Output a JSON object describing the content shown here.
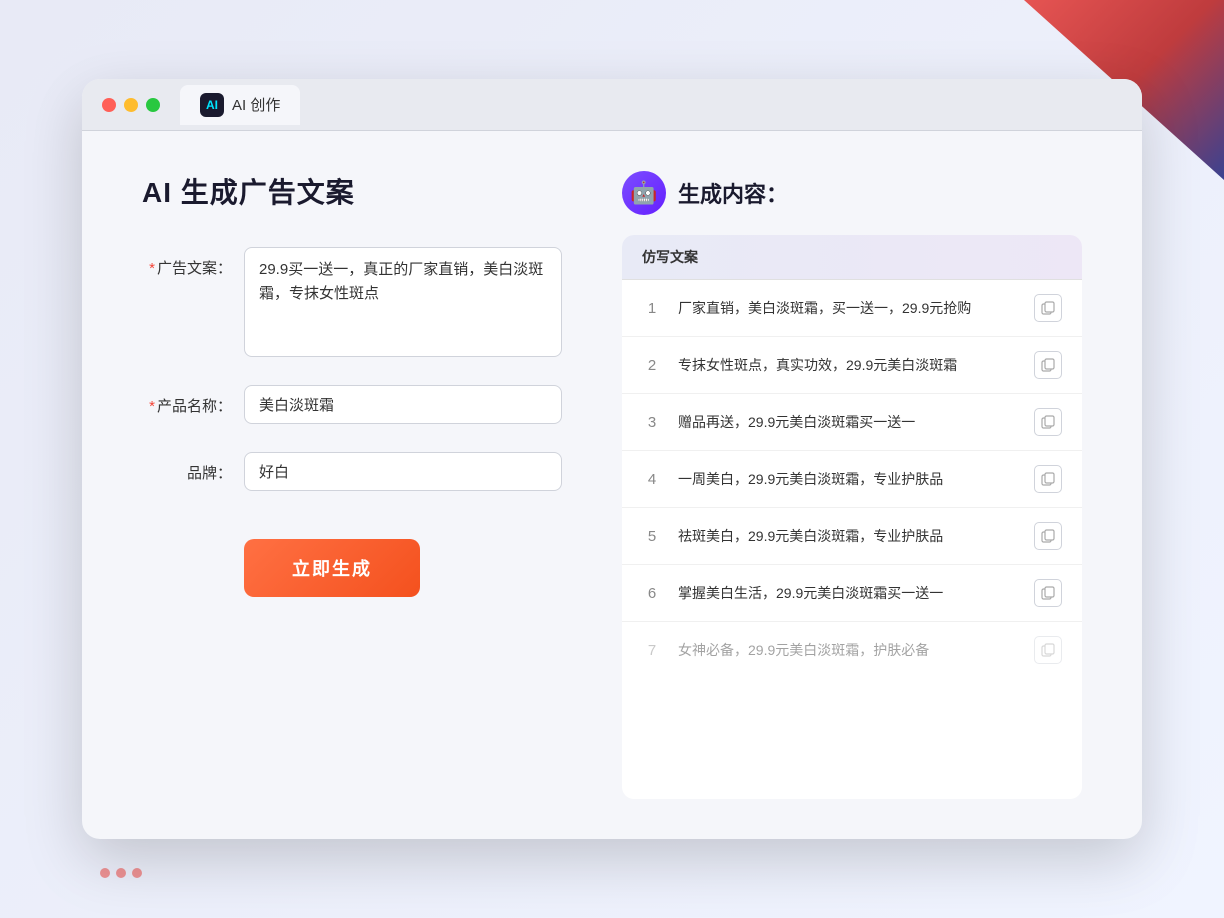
{
  "window": {
    "tab_label": "AI 创作",
    "tab_icon": "AI"
  },
  "left": {
    "page_title": "AI 生成广告文案",
    "form": {
      "ad_copy_label": "广告文案：",
      "ad_copy_required": "*",
      "ad_copy_value": "29.9买一送一，真正的厂家直销，美白淡斑霜，专抹女性斑点",
      "product_name_label": "产品名称：",
      "product_name_required": "*",
      "product_name_value": "美白淡斑霜",
      "brand_label": "品牌：",
      "brand_value": "好白"
    },
    "generate_button": "立即生成"
  },
  "right": {
    "section_title": "生成内容：",
    "table_header": "仿写文案",
    "results": [
      {
        "num": 1,
        "text": "厂家直销，美白淡斑霜，买一送一，29.9元抢购",
        "dimmed": false
      },
      {
        "num": 2,
        "text": "专抹女性斑点，真实功效，29.9元美白淡斑霜",
        "dimmed": false
      },
      {
        "num": 3,
        "text": "赠品再送，29.9元美白淡斑霜买一送一",
        "dimmed": false
      },
      {
        "num": 4,
        "text": "一周美白，29.9元美白淡斑霜，专业护肤品",
        "dimmed": false
      },
      {
        "num": 5,
        "text": "祛斑美白，29.9元美白淡斑霜，专业护肤品",
        "dimmed": false
      },
      {
        "num": 6,
        "text": "掌握美白生活，29.9元美白淡斑霜买一送一",
        "dimmed": false
      },
      {
        "num": 7,
        "text": "女神必备，29.9元美白淡斑霜，护肤必备",
        "dimmed": true
      }
    ]
  }
}
